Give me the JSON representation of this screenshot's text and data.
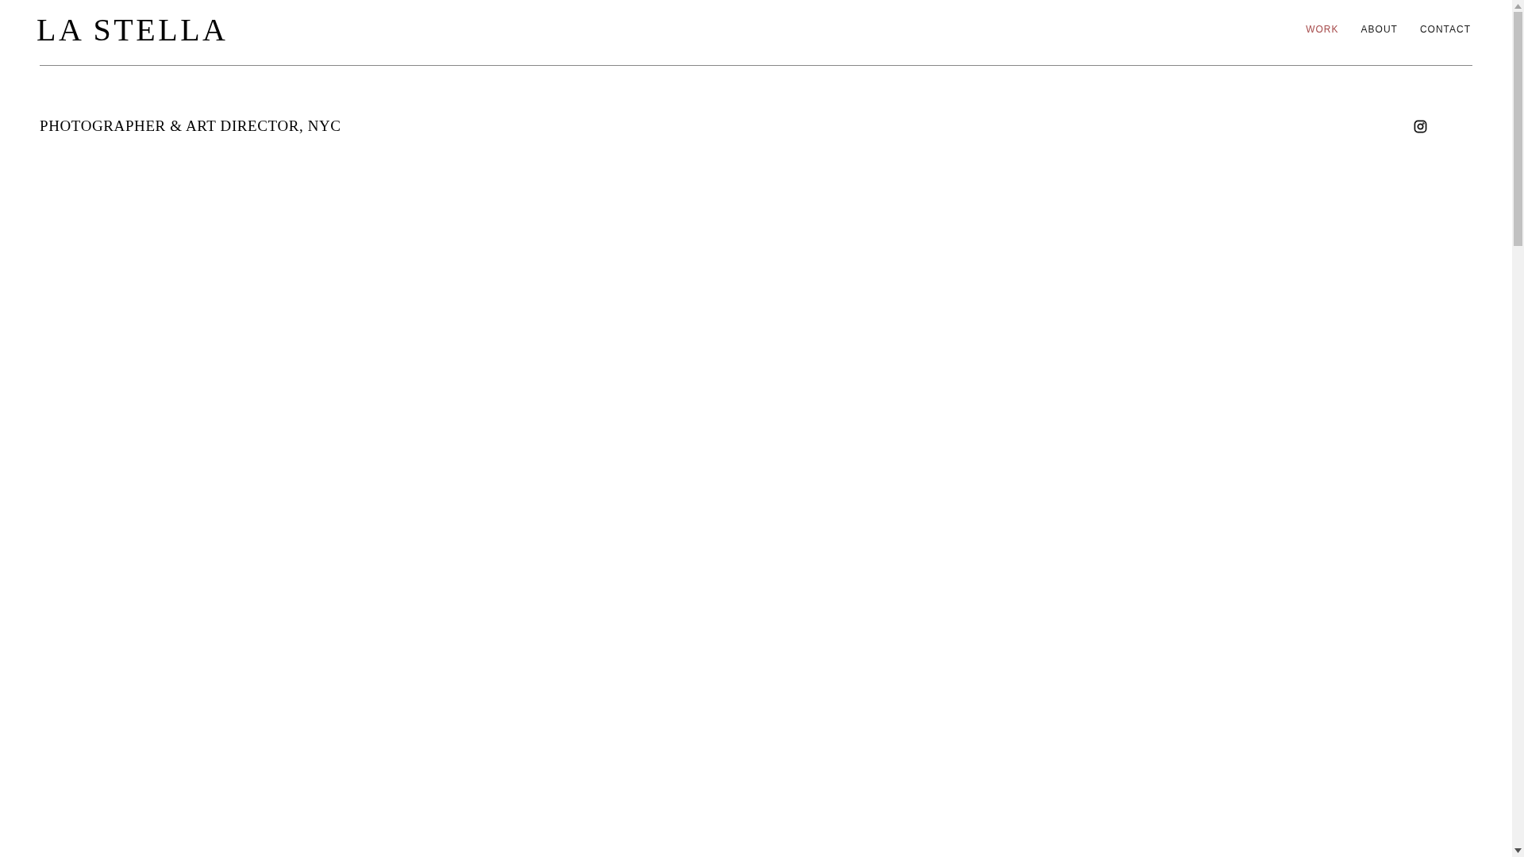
{
  "header": {
    "logo": "LA STELLA",
    "nav": [
      {
        "label": "WORK",
        "selected": true
      },
      {
        "label": "ABOUT",
        "selected": false
      },
      {
        "label": "CONTACT",
        "selected": false
      }
    ]
  },
  "tagline": "PHOTOGRAPHER & ART DIRECTOR, NYC"
}
